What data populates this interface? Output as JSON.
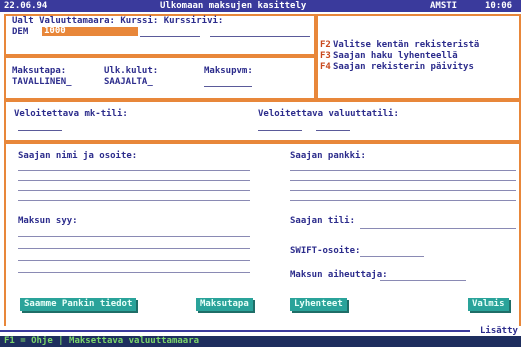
{
  "window": {
    "left_text": "22.06.94",
    "title": "Ulkomaan maksujen kasittely",
    "right_code": "AMSTI",
    "time": "10:06"
  },
  "top_form": {
    "label": "Ualt Valuuttamaara: Kurssi:  Kurssirivi:",
    "currency": "DEM",
    "amount_value": "1000"
  },
  "fkeys": [
    {
      "key": "F2",
      "label": "Valitse kentän rekisteristä"
    },
    {
      "key": "F3",
      "label": "Saajan haku lyhenteellä"
    },
    {
      "key": "F4",
      "label": "Saajan rekisterin päivitys"
    }
  ],
  "payment": {
    "label_1": "Maksutapa:",
    "value_1": "TAVALLINEN_",
    "label_2": "Ulk.kulut:",
    "value_2": "SAAJALTA_",
    "label_3": "Maksupvm:"
  },
  "accounts": {
    "left_label": "Veloitettava mk-tili:",
    "right_label": "Veloitettava valuuttatili:"
  },
  "payee": {
    "name_label": "Saajan nimi ja osoite:",
    "bank_label": "Saajan pankki:",
    "reason_label": "Maksun syy:",
    "account_label": "Saajan tili:",
    "swift_label": "SWIFT-osoite:",
    "fee_label": "Maksun aiheuttaja:"
  },
  "buttons": [
    {
      "label": "Saamme Pankin tiedot"
    },
    {
      "label": "Maksutapa"
    },
    {
      "label": "Lyhenteet"
    },
    {
      "label": "Valmis"
    }
  ],
  "status": {
    "right_label": "Lisätty",
    "bottom_text": "F1 = Ohje | Maksettava valuuttamaara"
  }
}
